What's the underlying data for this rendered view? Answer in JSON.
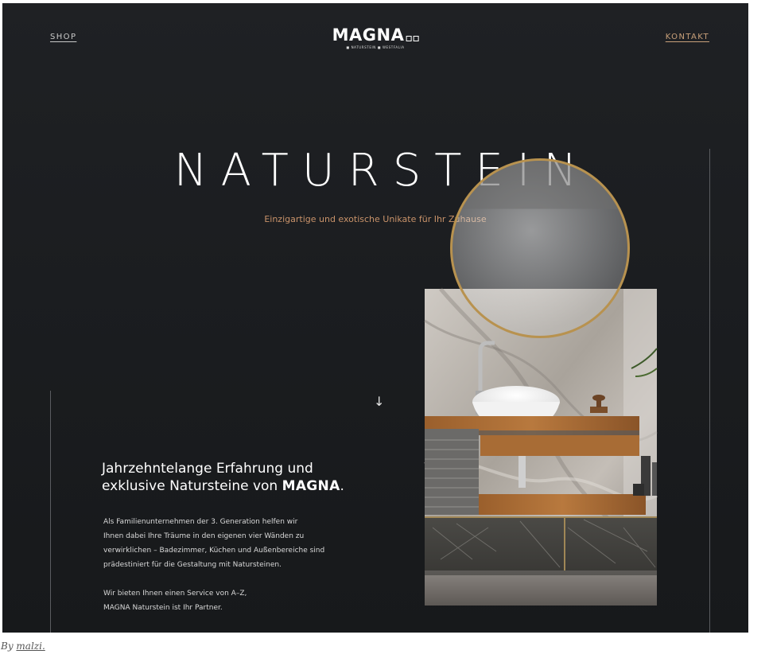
{
  "nav": {
    "shop_label": "SHOP",
    "kontakt_label": "KONTAKT"
  },
  "logo": {
    "name": "MAGNA",
    "subtitle": "■ NATURSTEIN ■ WESTFALIA"
  },
  "hero": {
    "title": "NATURSTEIN",
    "subtitle": "Einzigartige und exotische Unikate für Ihr Zuhause"
  },
  "scroll_indicator": "↓",
  "intro": {
    "heading_line1": "Jahrzehntelange Erfahrung und",
    "heading_line2_prefix": "exklusive Natursteine von ",
    "heading_brand": "MAGNA",
    "heading_suffix": ".",
    "paragraph1": [
      "Als Familienunternehmen der 3. Generation helfen wir",
      "Ihnen dabei Ihre Träume in den eigenen vier Wänden zu",
      "verwirklichen – Badezimmer, Küchen und Außenbereiche sind",
      "prädestiniert für die Gestaltung mit Natursteinen."
    ],
    "paragraph2": [
      "Wir bieten Ihnen einen Service von A–Z,",
      "MAGNA Naturstein ist Ihr Partner."
    ]
  },
  "credit": {
    "prefix": "By ",
    "author": "malzi."
  },
  "colors": {
    "background": "#1c1e21",
    "accent": "#c9936a",
    "text": "#ffffff"
  }
}
